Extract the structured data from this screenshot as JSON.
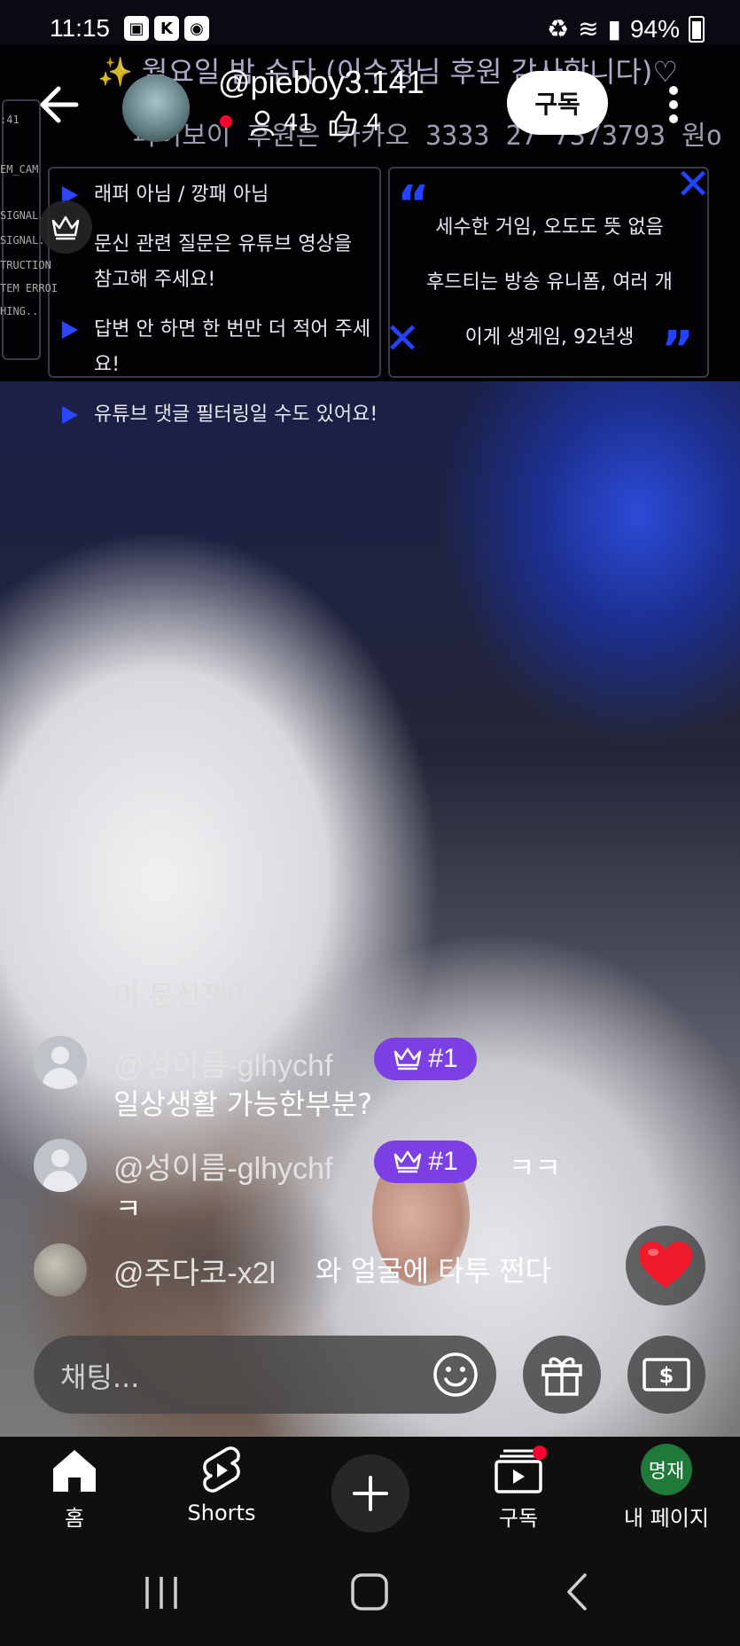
{
  "status_bar": {
    "time": "11:15",
    "battery": "94%"
  },
  "header": {
    "channel_name": "@pieboy3.141",
    "viewers": "41",
    "likes": "4",
    "subscribe_label": "구독"
  },
  "stream_overlay": {
    "title": "✨ 월요일 밤 수다 (이수정님 후원 감사합니다)♡",
    "ticker": "파이보이 후원은 카카오 3333 27 7373793 원o",
    "side_left": [
      ":41",
      "EM_CAM",
      "SIGNAL.",
      "SIGNAL.",
      "TRUCTION",
      "TEM ERROI",
      "HING.."
    ],
    "rules": [
      "래퍼 아님 / 깡패 아님",
      "문신 관련 질문은 유튜브 영상을",
      "참고해 주세요!",
      "답변 안 하면 한 번만 더 적어 주세요!",
      "유튜브 댓글 필터링일 수도 있어요!"
    ],
    "quote_lines": [
      "세수한 거임, 오도도 뜻 없음",
      "후드티는 방송 유니폼, 여러 개",
      "이게 생게임, 92년생"
    ]
  },
  "chat": {
    "prev_text": "이 문신쟁이는?",
    "messages": [
      {
        "author": "@성이름-glhychf",
        "badge": "#1",
        "text": "일상생활 가능한부분?"
      },
      {
        "author": "@성이름-glhychf",
        "badge": "#1",
        "text_line1": "ㅋㅋ",
        "text_line2": "ㅋ"
      },
      {
        "author": "@주다코-x2l",
        "text": "와 얼굴에 타투 쩐다"
      }
    ],
    "input_placeholder": "채팅..."
  },
  "bottom_nav": {
    "home": "홈",
    "shorts": "Shorts",
    "subscriptions": "구독",
    "my_page": "내 페이지",
    "my_page_avatar": "명재"
  },
  "colors": {
    "member_badge": "#7b3fe4",
    "live_red": "#ff0033",
    "accent_blue": "#2c46ff"
  }
}
